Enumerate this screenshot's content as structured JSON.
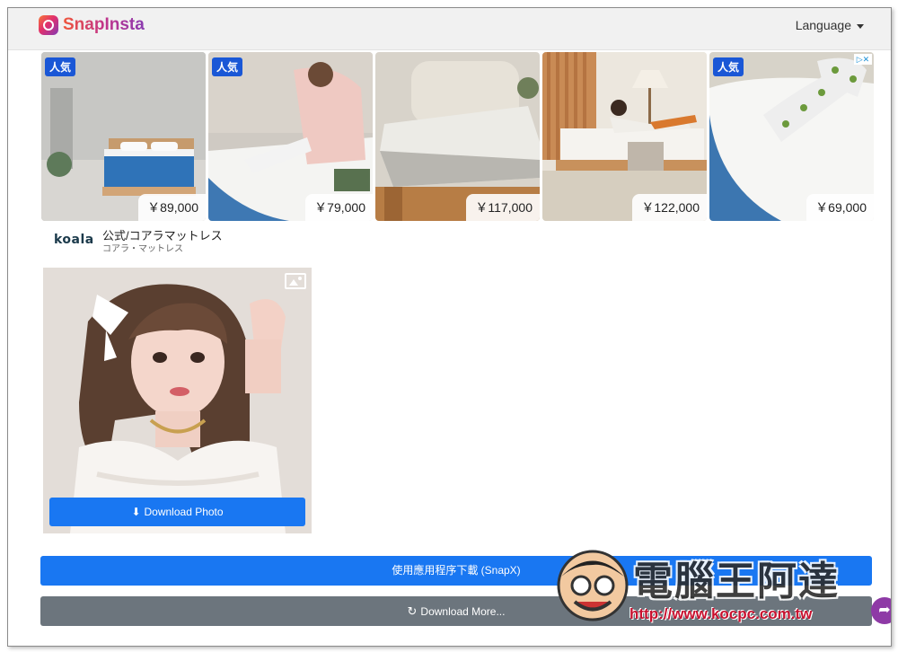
{
  "navbar": {
    "brand": "SnapInsta",
    "language_label": "Language"
  },
  "ads": {
    "tiles": [
      {
        "badge": "人気",
        "price": "￥89,000"
      },
      {
        "badge": "人気",
        "price": "￥79,000"
      },
      {
        "badge": "",
        "price": "￥117,000"
      },
      {
        "badge": "",
        "price": "￥122,000"
      },
      {
        "badge": "人気",
        "price": "￥69,000"
      }
    ],
    "brand_logo": "koala",
    "title": "公式/コアラマットレス",
    "subtitle": "コアラ・マットレス"
  },
  "media": {
    "download_photo_label": "Download Photo"
  },
  "buttons": {
    "app_download": "使用應用程序下載 (SnapX)",
    "download_more": "Download More..."
  },
  "watermark": {
    "title": "電腦王阿達",
    "url": "http://www.kocpc.com.tw"
  },
  "icons": {
    "download": "download-icon",
    "refresh": "refresh-icon",
    "image": "image-icon",
    "share": "share-icon"
  },
  "colors": {
    "primary": "#1977f2",
    "secondary": "#6c757d",
    "badge": "#1a57d6",
    "brand_gradient_start": "#f0573a",
    "brand_gradient_end": "#8a3ab0"
  }
}
